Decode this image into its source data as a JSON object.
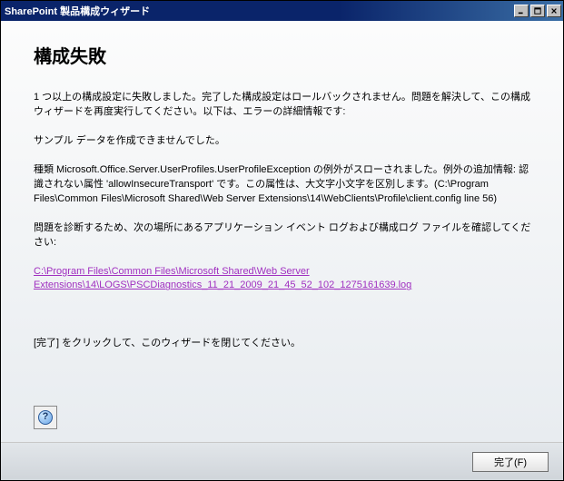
{
  "window": {
    "title": "SharePoint 製品構成ウィザード"
  },
  "heading": "構成失敗",
  "para1": "1 つ以上の構成設定に失敗しました。完了した構成設定はロールバックされません。問題を解決して、この構成ウィザードを再度実行してください。以下は、エラーの詳細情報です:",
  "para2": "サンプル データを作成できませんでした。",
  "para3": "種類 Microsoft.Office.Server.UserProfiles.UserProfileException の例外がスローされました。例外の追加情報: 認識されない属性 'allowInsecureTransport' です。この属性は、大文字小文字を区別します。(C:\\Program Files\\Common Files\\Microsoft Shared\\Web Server Extensions\\14\\WebClients\\Profile\\client.config line 56)",
  "para4": "問題を診断するため、次の場所にあるアプリケーション イベント ログおよび構成ログ ファイルを確認してください:",
  "log_link": "C:\\Program Files\\Common Files\\Microsoft Shared\\Web Server Extensions\\14\\LOGS\\PSCDiagnostics_11_21_2009_21_45_52_102_1275161639.log",
  "close_hint": "[完了] をクリックして、このウィザードを閉じてください。",
  "help_glyph": "?",
  "finish_label": "完了(F)"
}
